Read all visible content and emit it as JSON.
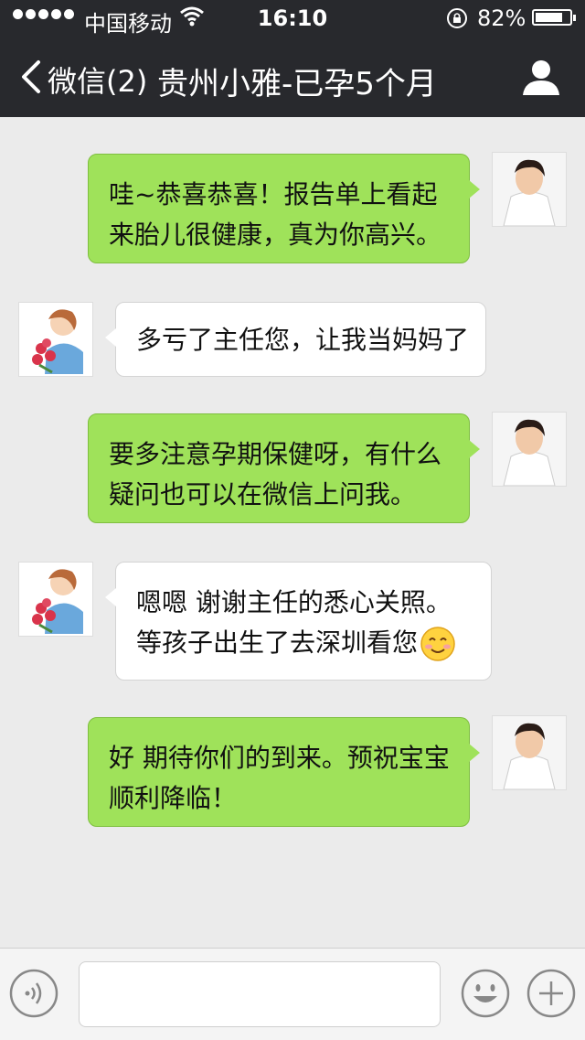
{
  "status_bar": {
    "carrier": "中国移动",
    "time": "16:10",
    "battery": "82%",
    "battery_level": 0.82
  },
  "nav": {
    "back_label": "微信(2)",
    "title": "贵州小雅-已孕5个月"
  },
  "messages": [
    {
      "side": "right",
      "sender": "doctor",
      "lines": [
        "哇~恭喜恭喜！报告单上看起",
        "来胎儿很健康，真为你高兴。"
      ]
    },
    {
      "side": "left",
      "sender": "patient",
      "lines": [
        "多亏了主任您，让我当妈妈了"
      ]
    },
    {
      "side": "right",
      "sender": "doctor",
      "lines": [
        "要多注意孕期保健呀，有什么",
        "疑问也可以在微信上问我。"
      ]
    },
    {
      "side": "left",
      "sender": "patient",
      "lines": [
        "嗯嗯 谢谢主任的悉心关照。",
        "等孩子出生了去深圳看您"
      ],
      "trailing_icon": "smiling-face-emoji"
    },
    {
      "side": "right",
      "sender": "doctor",
      "lines": [
        "好 期待你们的到来。预祝宝宝",
        "顺利降临！"
      ]
    }
  ],
  "input_bar": {
    "voice_icon": "voice-icon",
    "emoji_icon": "emoji-face-icon",
    "plus_icon": "plus-icon",
    "text_value": ""
  },
  "colors": {
    "nav_bg": "#28292d",
    "chat_bg": "#ebebeb",
    "outgoing_bubble": "#9fe25a",
    "incoming_bubble": "#ffffff"
  }
}
